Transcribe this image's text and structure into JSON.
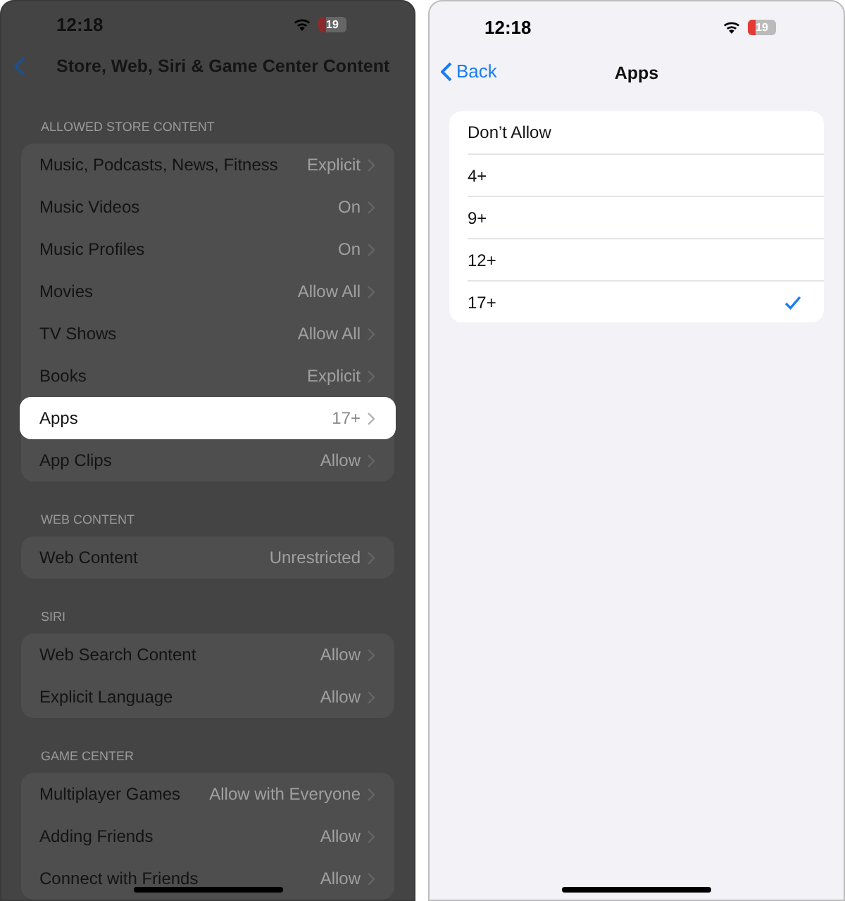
{
  "left_screen": {
    "status_bar": {
      "time": "12:18",
      "battery": "19"
    },
    "nav": {
      "title": "Store, Web, Siri & Game Center Content"
    },
    "sections": [
      {
        "header": "ALLOWED STORE CONTENT",
        "rows": [
          {
            "label": "Music, Podcasts, News, Fitness",
            "value": "Explicit",
            "highlighted": false
          },
          {
            "label": "Music Videos",
            "value": "On",
            "highlighted": false
          },
          {
            "label": "Music Profiles",
            "value": "On",
            "highlighted": false
          },
          {
            "label": "Movies",
            "value": "Allow All",
            "highlighted": false
          },
          {
            "label": "TV Shows",
            "value": "Allow All",
            "highlighted": false
          },
          {
            "label": "Books",
            "value": "Explicit",
            "highlighted": false
          },
          {
            "label": "Apps",
            "value": "17+",
            "highlighted": true
          },
          {
            "label": "App Clips",
            "value": "Allow",
            "highlighted": false
          }
        ]
      },
      {
        "header": "WEB CONTENT",
        "rows": [
          {
            "label": "Web Content",
            "value": "Unrestricted",
            "highlighted": false
          }
        ]
      },
      {
        "header": "SIRI",
        "rows": [
          {
            "label": "Web Search Content",
            "value": "Allow",
            "highlighted": false
          },
          {
            "label": "Explicit Language",
            "value": "Allow",
            "highlighted": false
          }
        ]
      },
      {
        "header": "GAME CENTER",
        "rows": [
          {
            "label": "Multiplayer Games",
            "value": "Allow with Everyone",
            "highlighted": false
          },
          {
            "label": "Adding Friends",
            "value": "Allow",
            "highlighted": false
          },
          {
            "label": "Connect with Friends",
            "value": "Allow",
            "highlighted": false
          }
        ]
      }
    ]
  },
  "right_screen": {
    "status_bar": {
      "time": "12:18",
      "battery": "19"
    },
    "nav": {
      "back": "Back",
      "title": "Apps"
    },
    "options": [
      {
        "label": "Don’t Allow",
        "selected": false
      },
      {
        "label": "4+",
        "selected": false
      },
      {
        "label": "9+",
        "selected": false
      },
      {
        "label": "12+",
        "selected": false
      },
      {
        "label": "17+",
        "selected": true
      }
    ]
  }
}
